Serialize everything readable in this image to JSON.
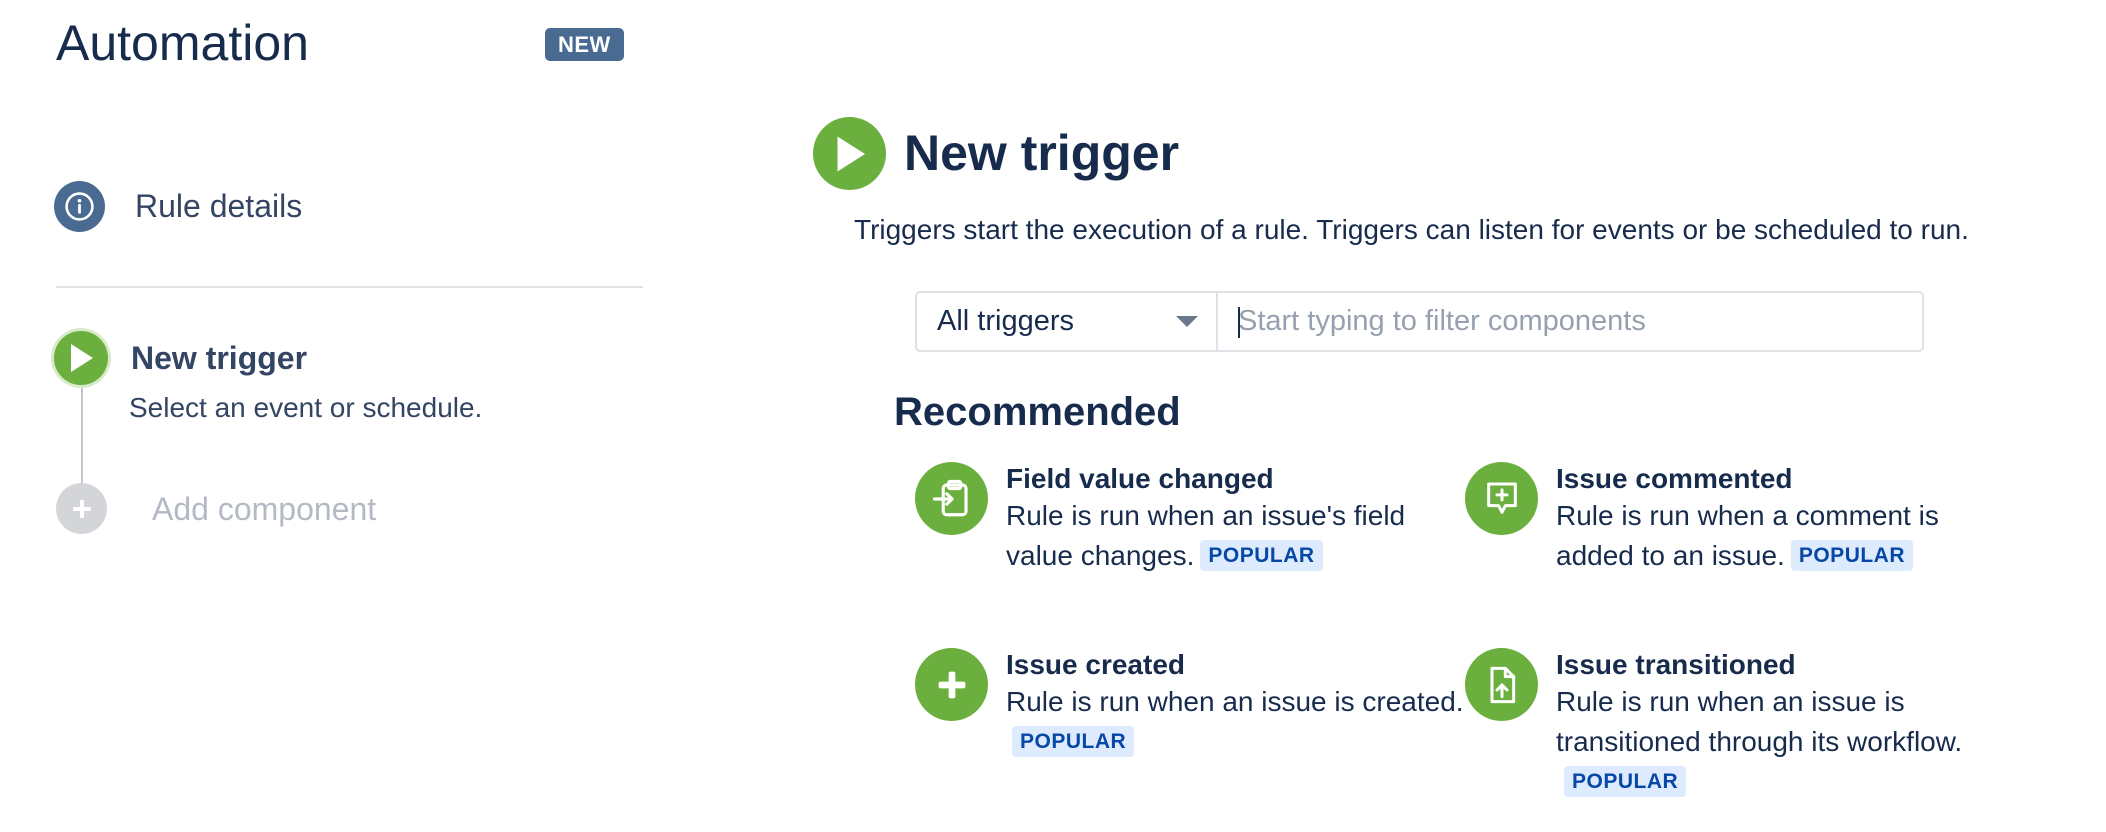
{
  "sidebar": {
    "title": "Automation",
    "badge": "NEW",
    "rule_details": {
      "label": "Rule details",
      "icon": "info-icon"
    },
    "trigger_step": {
      "title": "New trigger",
      "description": "Select an event or schedule.",
      "icon": "play-icon"
    },
    "add_component": {
      "label": "Add component",
      "icon": "plus-icon"
    }
  },
  "main": {
    "title": "New trigger",
    "description": "Triggers start the execution of a rule. Triggers can listen for events or be scheduled to run.",
    "filter": {
      "select_value": "All triggers",
      "search_placeholder": "Start typing to filter components"
    },
    "recommended": {
      "title": "Recommended",
      "cards": [
        {
          "title": "Field value changed",
          "description": "Rule is run when an issue's field value changes.",
          "badge": "POPULAR",
          "icon": "field-change-icon"
        },
        {
          "title": "Issue commented",
          "description": "Rule is run when a comment is added to an issue.",
          "badge": "POPULAR",
          "icon": "comment-icon"
        },
        {
          "title": "Issue created",
          "description": "Rule is run when an issue is created.",
          "badge": "POPULAR",
          "icon": "plus-icon"
        },
        {
          "title": "Issue transitioned",
          "description": "Rule is run when an issue is transitioned through its workflow.",
          "badge": "POPULAR",
          "icon": "transition-icon"
        }
      ]
    }
  },
  "colors": {
    "accent_green": "#6bb03e",
    "badge_blue": "#4a6b91",
    "text_dark": "#172b4d",
    "popular_bg": "#deebff",
    "popular_text": "#0747a6"
  }
}
